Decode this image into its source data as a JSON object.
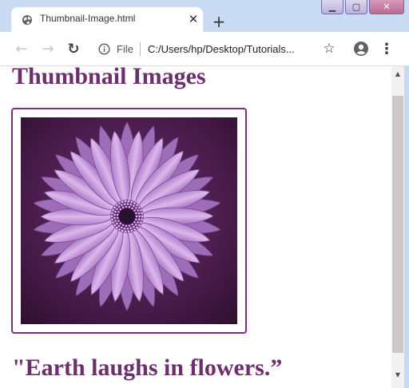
{
  "tab": {
    "title": "Thumbnail-Image.html",
    "favicon_icon": "globe-icon",
    "close_label": "✕",
    "new_tab_label": "+"
  },
  "window": {
    "minimize_label": "▁",
    "maximize_label": "▢",
    "close_label": "✕"
  },
  "toolbar": {
    "back_label": "←",
    "forward_label": "→",
    "reload_label": "↻",
    "site_label": "File",
    "url": "C:/Users/hp/Desktop/Tutorials...",
    "bookmark_label": "☆",
    "menu_label": "⋮"
  },
  "page": {
    "heading": "Thumbnail Images",
    "image_alt": "Purple daisy flower",
    "quote": "\"Earth laughs in flowers.”"
  },
  "scrollbar": {
    "up_label": "▲",
    "down_label": "▼"
  },
  "colors": {
    "heading": "#6b2f6e",
    "frame_border": "#7a2f7d",
    "chrome": "#c9dcf3"
  }
}
